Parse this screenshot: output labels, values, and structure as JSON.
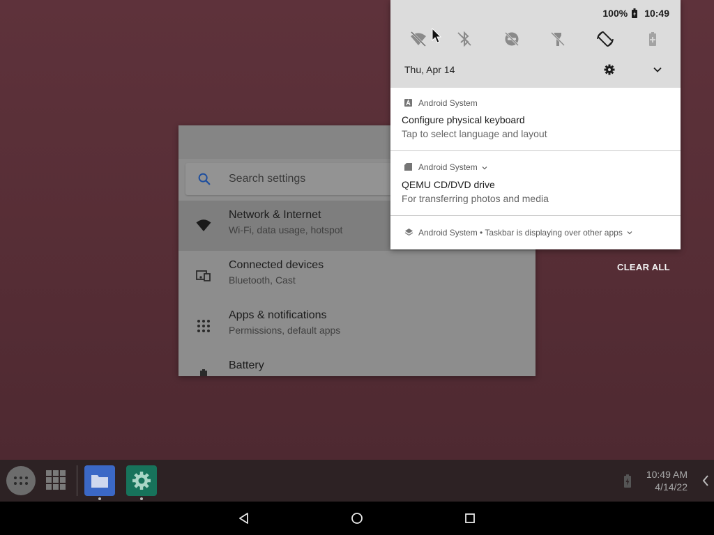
{
  "settings": {
    "search_placeholder": "Search settings",
    "items": [
      {
        "title": "Network & Internet",
        "subtitle": "Wi-Fi, data usage, hotspot"
      },
      {
        "title": "Connected devices",
        "subtitle": "Bluetooth, Cast"
      },
      {
        "title": "Apps & notifications",
        "subtitle": "Permissions, default apps"
      },
      {
        "title": "Battery",
        "subtitle": ""
      }
    ]
  },
  "status_bar": {
    "battery_percent": "100%",
    "time": "10:49"
  },
  "quick_settings": {
    "date": "Thu, Apr 14",
    "tiles": [
      "wifi-off-icon",
      "bluetooth-off-icon",
      "dnd-off-icon",
      "flashlight-off-icon",
      "auto-rotate-icon",
      "battery-saver-icon"
    ]
  },
  "notifications": [
    {
      "app": "Android System",
      "title": "Configure physical keyboard",
      "text": "Tap to select language and layout"
    },
    {
      "app": "Android System",
      "title": "QEMU CD/DVD drive",
      "text": "For transferring photos and media"
    },
    {
      "app": "Android System",
      "summary": "Taskbar is displaying over other apps"
    }
  ],
  "clear_all_label": "CLEAR ALL",
  "taskbar": {
    "clock_time": "10:49 AM",
    "clock_date": "4/14/22"
  },
  "colors": {
    "wallpaper": "#5b3139",
    "taskbar": "#2d2224",
    "files_app": "#3b68c6",
    "settings_app": "#17735b"
  }
}
